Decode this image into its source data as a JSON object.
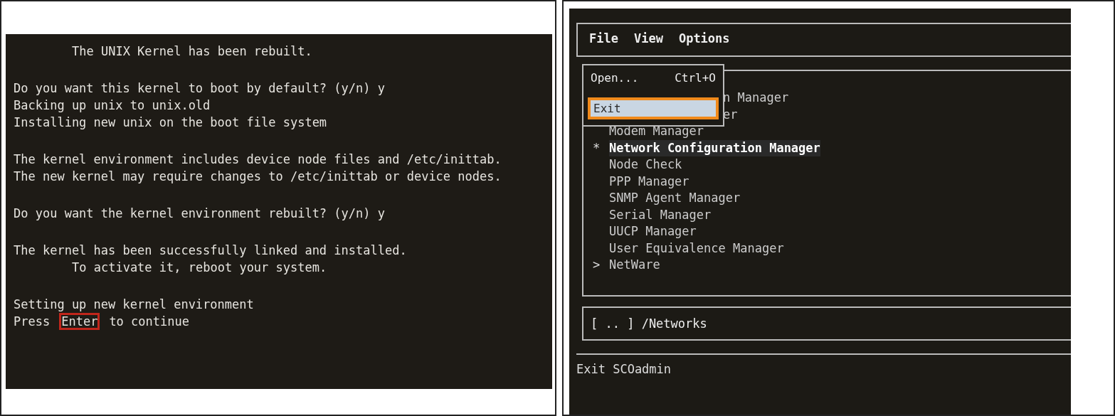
{
  "left_screen": {
    "paragraphs": [
      [
        {
          "kind": "indented",
          "parts": [
            {
              "text": "The UNIX Kernel has been rebuilt.",
              "callout": false
            }
          ]
        }
      ],
      [
        {
          "kind": "line",
          "parts": [
            {
              "text": "Do you want this kernel to boot by default? (y/n) y",
              "callout": false
            }
          ]
        },
        {
          "kind": "line",
          "parts": [
            {
              "text": "Backing up unix to unix.old",
              "callout": false
            }
          ]
        },
        {
          "kind": "line",
          "parts": [
            {
              "text": "Installing new unix on the boot file system",
              "callout": false
            }
          ]
        }
      ],
      [
        {
          "kind": "line",
          "parts": [
            {
              "text": "The kernel environment includes device node files and /etc/inittab.",
              "callout": false
            }
          ]
        },
        {
          "kind": "line",
          "parts": [
            {
              "text": "The new kernel may require changes to /etc/inittab or device nodes.",
              "callout": false
            }
          ]
        }
      ],
      [
        {
          "kind": "line",
          "parts": [
            {
              "text": "Do you want the kernel environment rebuilt? (y/n) y",
              "callout": false
            }
          ]
        }
      ],
      [
        {
          "kind": "line",
          "parts": [
            {
              "text": "The kernel has been successfully linked and installed.",
              "callout": false
            }
          ]
        },
        {
          "kind": "indented",
          "parts": [
            {
              "text": "To activate it, reboot your system.",
              "callout": false
            }
          ]
        }
      ],
      [
        {
          "kind": "line",
          "parts": [
            {
              "text": "Setting up new kernel environment",
              "callout": false
            }
          ]
        },
        {
          "kind": "line",
          "parts": [
            {
              "text": "Press",
              "callout": false
            },
            {
              "text": "Enter",
              "callout": true
            },
            {
              "text": "to continue",
              "callout": false
            }
          ]
        }
      ]
    ]
  },
  "right_screen": {
    "menu_bar": [
      "File",
      "View",
      "Options"
    ],
    "file_menu": [
      {
        "label": "Open...",
        "shortcut": "Ctrl+O",
        "selected": false,
        "callout": false
      },
      {
        "label": "Exit",
        "selected": true,
        "callout": true
      }
    ],
    "list_items": [
      {
        "kind": "partial",
        "text": "n Manager",
        "selected": false
      },
      {
        "kind": "partial",
        "text": "er",
        "selected": false
      },
      {
        "text": "Modem Manager",
        "selected": false
      },
      {
        "marker": "*",
        "text": "Network Configuration Manager",
        "selected": true
      },
      {
        "text": "Node Check",
        "selected": false
      },
      {
        "text": "PPP Manager",
        "selected": false
      },
      {
        "text": "SNMP Agent Manager",
        "selected": false
      },
      {
        "text": "Serial Manager",
        "selected": false
      },
      {
        "text": "UUCP Manager",
        "selected": false
      },
      {
        "text": "User Equivalence Manager",
        "selected": false
      },
      {
        "marker": ">",
        "text": "NetWare",
        "selected": false
      }
    ],
    "path": "[ .. ] /Networks",
    "status_bar": "Exit SCOadmin"
  }
}
